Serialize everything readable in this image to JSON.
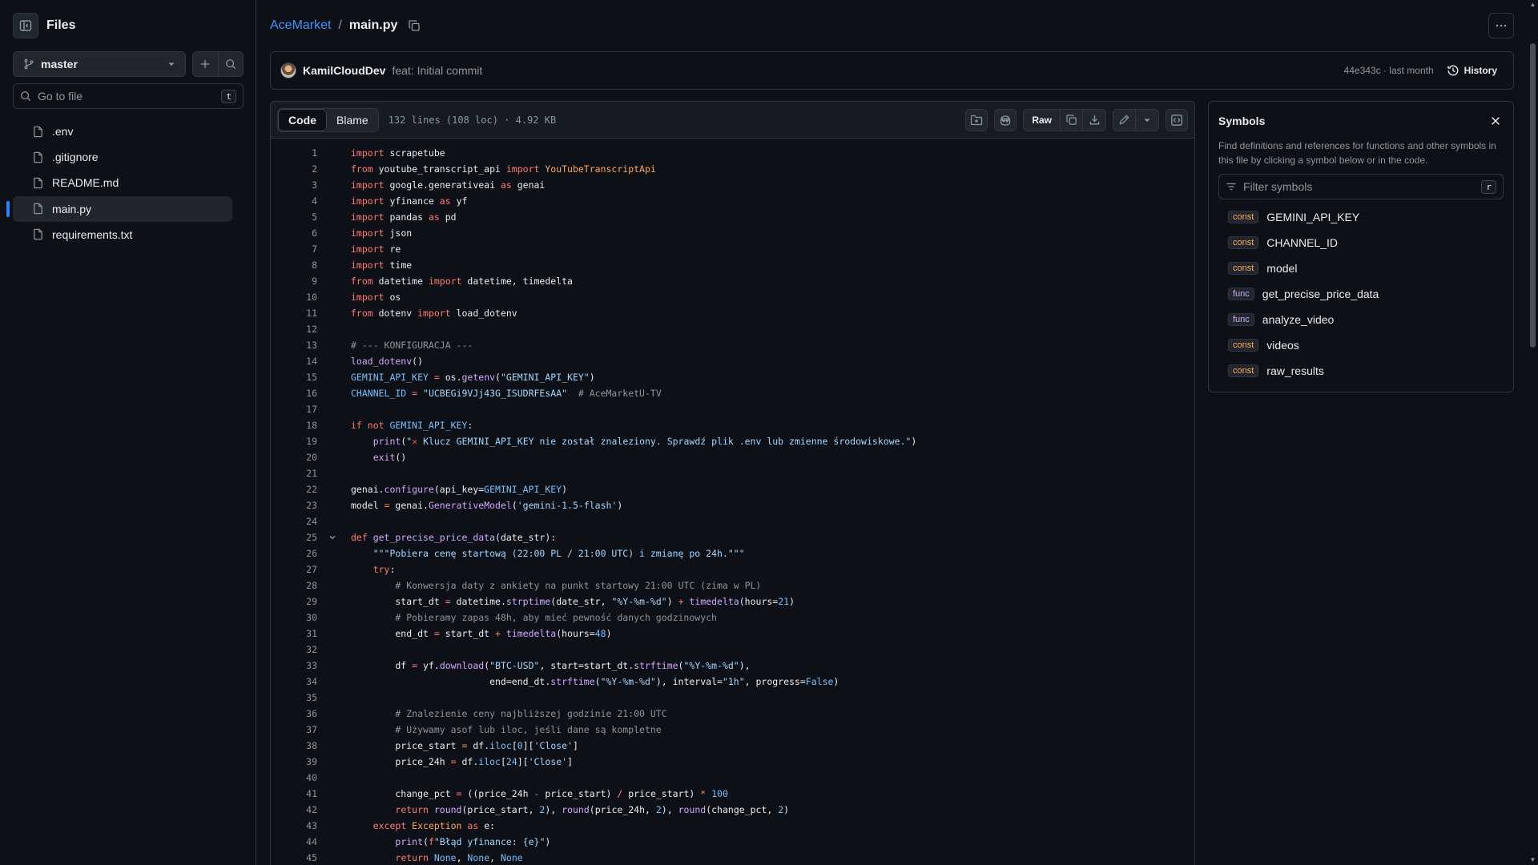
{
  "sidebar": {
    "title": "Files",
    "branch": "master",
    "goto_placeholder": "Go to file",
    "goto_shortcut": "t",
    "files": [
      ".env",
      ".gitignore",
      "README.md",
      "main.py",
      "requirements.txt"
    ],
    "active_file": "main.py"
  },
  "breadcrumb": {
    "repo": "AceMarket",
    "separator": "/",
    "file": "main.py"
  },
  "commit": {
    "author": "KamilCloudDev",
    "message": "feat: Initial commit",
    "meta": "44e343c · last month",
    "history_label": "History"
  },
  "code_toolbar": {
    "tab_code": "Code",
    "tab_blame": "Blame",
    "file_info": "132 lines (108 loc) · 4.92 KB",
    "raw_label": "Raw"
  },
  "code_lines": [
    [
      [
        "kw",
        "import"
      ],
      [
        "t",
        " scrapetube"
      ]
    ],
    [
      [
        "kw",
        "from"
      ],
      [
        "t",
        " youtube_transcript_api "
      ],
      [
        "kw",
        "import"
      ],
      [
        "vr",
        " YouTubeTranscriptApi"
      ]
    ],
    [
      [
        "kw",
        "import"
      ],
      [
        "t",
        " google.generativeai "
      ],
      [
        "kw",
        "as"
      ],
      [
        "t",
        " genai"
      ]
    ],
    [
      [
        "kw",
        "import"
      ],
      [
        "t",
        " yfinance "
      ],
      [
        "kw",
        "as"
      ],
      [
        "t",
        " yf"
      ]
    ],
    [
      [
        "kw",
        "import"
      ],
      [
        "t",
        " pandas "
      ],
      [
        "kw",
        "as"
      ],
      [
        "t",
        " pd"
      ]
    ],
    [
      [
        "kw",
        "import"
      ],
      [
        "t",
        " json"
      ]
    ],
    [
      [
        "kw",
        "import"
      ],
      [
        "t",
        " re"
      ]
    ],
    [
      [
        "kw",
        "import"
      ],
      [
        "t",
        " time"
      ]
    ],
    [
      [
        "kw",
        "from"
      ],
      [
        "t",
        " datetime "
      ],
      [
        "kw",
        "import"
      ],
      [
        "t",
        " datetime, timedelta"
      ]
    ],
    [
      [
        "kw",
        "import"
      ],
      [
        "t",
        " os"
      ]
    ],
    [
      [
        "kw",
        "from"
      ],
      [
        "t",
        " dotenv "
      ],
      [
        "kw",
        "import"
      ],
      [
        "t",
        " load_dotenv"
      ]
    ],
    [],
    [
      [
        "cm",
        "# --- KONFIGURACJA ---"
      ]
    ],
    [
      [
        "fn",
        "load_dotenv"
      ],
      [
        "t",
        "()"
      ]
    ],
    [
      [
        "cn",
        "GEMINI_API_KEY"
      ],
      [
        "kw",
        " ="
      ],
      [
        "t",
        " os."
      ],
      [
        "fn",
        "getenv"
      ],
      [
        "t",
        "("
      ],
      [
        "str",
        "\"GEMINI_API_KEY\""
      ],
      [
        "t",
        ")"
      ]
    ],
    [
      [
        "cn",
        "CHANNEL_ID"
      ],
      [
        "kw",
        " ="
      ],
      [
        "str",
        " \"UCBEGi9VJj43G_ISUDRFEsAA\""
      ],
      [
        "cm",
        "  # AceMarketU-TV"
      ]
    ],
    [],
    [
      [
        "kw",
        "if not"
      ],
      [
        "cn",
        " GEMINI_API_KEY"
      ],
      [
        "t",
        ":"
      ]
    ],
    [
      [
        "t",
        "    "
      ],
      [
        "fn",
        "print"
      ],
      [
        "t",
        "("
      ],
      [
        "str",
        "\""
      ],
      [
        "x",
        "✕"
      ],
      [
        "str",
        " Klucz GEMINI_API_KEY nie został znaleziony. Sprawdź plik .env lub zmienne środowiskowe.\""
      ],
      [
        "t",
        ")"
      ]
    ],
    [
      [
        "t",
        "    "
      ],
      [
        "fn",
        "exit"
      ],
      [
        "t",
        "()"
      ]
    ],
    [],
    [
      [
        "t",
        "genai."
      ],
      [
        "fn",
        "configure"
      ],
      [
        "t",
        "(api_key="
      ],
      [
        "cn",
        "GEMINI_API_KEY"
      ],
      [
        "t",
        ")"
      ]
    ],
    [
      [
        "t",
        "model "
      ],
      [
        "kw",
        "="
      ],
      [
        "t",
        " genai."
      ],
      [
        "fn",
        "GenerativeModel"
      ],
      [
        "t",
        "("
      ],
      [
        "str",
        "'gemini-1.5-flash'"
      ],
      [
        "t",
        ")"
      ]
    ],
    [],
    [
      [
        "kw",
        "def"
      ],
      [
        "fn",
        " get_precise_price_data"
      ],
      [
        "t",
        "(date_str):"
      ]
    ],
    [
      [
        "t",
        "    "
      ],
      [
        "str",
        "\"\"\"Pobiera cenę startową (22:00 PL / 21:00 UTC) i zmianę po 24h.\"\"\""
      ]
    ],
    [
      [
        "t",
        "    "
      ],
      [
        "kw",
        "try"
      ],
      [
        "t",
        ":"
      ]
    ],
    [
      [
        "t",
        "        "
      ],
      [
        "cm",
        "# Konwersja daty z ankiety na punkt startowy 21:00 UTC (zima w PL)"
      ]
    ],
    [
      [
        "t",
        "        start_dt "
      ],
      [
        "kw",
        "="
      ],
      [
        "t",
        " datetime."
      ],
      [
        "fn",
        "strptime"
      ],
      [
        "t",
        "(date_str, "
      ],
      [
        "str",
        "\"%Y-%m-%d\""
      ],
      [
        "t",
        ") "
      ],
      [
        "kw",
        "+"
      ],
      [
        "fn",
        " timedelta"
      ],
      [
        "t",
        "(hours="
      ],
      [
        "cn",
        "21"
      ],
      [
        "t",
        ")"
      ]
    ],
    [
      [
        "t",
        "        "
      ],
      [
        "cm",
        "# Pobieramy zapas 48h, aby mieć pewność danych godzinowych"
      ]
    ],
    [
      [
        "t",
        "        end_dt "
      ],
      [
        "kw",
        "="
      ],
      [
        "t",
        " start_dt "
      ],
      [
        "kw",
        "+"
      ],
      [
        "fn",
        " timedelta"
      ],
      [
        "t",
        "(hours="
      ],
      [
        "cn",
        "48"
      ],
      [
        "t",
        ")"
      ]
    ],
    [],
    [
      [
        "t",
        "        df "
      ],
      [
        "kw",
        "="
      ],
      [
        "t",
        " yf."
      ],
      [
        "fn",
        "download"
      ],
      [
        "t",
        "("
      ],
      [
        "str",
        "\"BTC-USD\""
      ],
      [
        "t",
        ", start=start_dt."
      ],
      [
        "fn",
        "strftime"
      ],
      [
        "t",
        "("
      ],
      [
        "str",
        "\"%Y-%m-%d\""
      ],
      [
        "t",
        "),"
      ]
    ],
    [
      [
        "t",
        "                         end=end_dt."
      ],
      [
        "fn",
        "strftime"
      ],
      [
        "t",
        "("
      ],
      [
        "str",
        "\"%Y-%m-%d\""
      ],
      [
        "t",
        "), interval="
      ],
      [
        "str",
        "\"1h\""
      ],
      [
        "t",
        ", progress="
      ],
      [
        "cn",
        "False"
      ],
      [
        "t",
        ")"
      ]
    ],
    [],
    [
      [
        "t",
        "        "
      ],
      [
        "cm",
        "# Znalezienie ceny najbliższej godzinie 21:00 UTC"
      ]
    ],
    [
      [
        "t",
        "        "
      ],
      [
        "cm",
        "# Używamy asof lub iloc, jeśli dane są kompletne"
      ]
    ],
    [
      [
        "t",
        "        price_start "
      ],
      [
        "kw",
        "="
      ],
      [
        "t",
        " df."
      ],
      [
        "cn",
        "iloc"
      ],
      [
        "t",
        "["
      ],
      [
        "cn",
        "0"
      ],
      [
        "t",
        "]["
      ],
      [
        "str",
        "'Close'"
      ],
      [
        "t",
        "]"
      ]
    ],
    [
      [
        "t",
        "        price_24h "
      ],
      [
        "kw",
        "="
      ],
      [
        "t",
        " df."
      ],
      [
        "cn",
        "iloc"
      ],
      [
        "t",
        "["
      ],
      [
        "cn",
        "24"
      ],
      [
        "t",
        "]["
      ],
      [
        "str",
        "'Close'"
      ],
      [
        "t",
        "]"
      ]
    ],
    [],
    [
      [
        "t",
        "        change_pct "
      ],
      [
        "kw",
        "="
      ],
      [
        "t",
        " ((price_24h "
      ],
      [
        "kw",
        "-"
      ],
      [
        "t",
        " price_start) "
      ],
      [
        "kw",
        "/"
      ],
      [
        "t",
        " price_start) "
      ],
      [
        "kw",
        "*"
      ],
      [
        "cn",
        " 100"
      ]
    ],
    [
      [
        "t",
        "        "
      ],
      [
        "kw",
        "return"
      ],
      [
        "fn",
        " round"
      ],
      [
        "t",
        "(price_start, "
      ],
      [
        "cn",
        "2"
      ],
      [
        "t",
        "), "
      ],
      [
        "fn",
        "round"
      ],
      [
        "t",
        "(price_24h, "
      ],
      [
        "cn",
        "2"
      ],
      [
        "t",
        "), "
      ],
      [
        "fn",
        "round"
      ],
      [
        "t",
        "(change_pct, "
      ],
      [
        "cn",
        "2"
      ],
      [
        "t",
        ")"
      ]
    ],
    [
      [
        "t",
        "    "
      ],
      [
        "kw",
        "except"
      ],
      [
        "vr",
        " Exception"
      ],
      [
        "kw",
        " as"
      ],
      [
        "t",
        " e:"
      ]
    ],
    [
      [
        "t",
        "        "
      ],
      [
        "fn",
        "print"
      ],
      [
        "t",
        "("
      ],
      [
        "kw",
        "f"
      ],
      [
        "str",
        "\"Błąd yfinance: {e}\""
      ],
      [
        "t",
        ")"
      ]
    ],
    [
      [
        "t",
        "        "
      ],
      [
        "kw",
        "return"
      ],
      [
        "cn",
        " None"
      ],
      [
        "t",
        ", "
      ],
      [
        "cn",
        "None"
      ],
      [
        "t",
        ", "
      ],
      [
        "cn",
        "None"
      ]
    ]
  ],
  "fold_line": 25,
  "symbols": {
    "title": "Symbols",
    "description": "Find definitions and references for functions and other symbols in this file by clicking a symbol below or in the code.",
    "filter_placeholder": "Filter symbols",
    "filter_shortcut": "r",
    "items": [
      {
        "kind": "const",
        "name": "GEMINI_API_KEY"
      },
      {
        "kind": "const",
        "name": "CHANNEL_ID"
      },
      {
        "kind": "const",
        "name": "model"
      },
      {
        "kind": "func",
        "name": "get_precise_price_data"
      },
      {
        "kind": "func",
        "name": "analyze_video"
      },
      {
        "kind": "const",
        "name": "videos"
      },
      {
        "kind": "const",
        "name": "raw_results"
      }
    ]
  }
}
